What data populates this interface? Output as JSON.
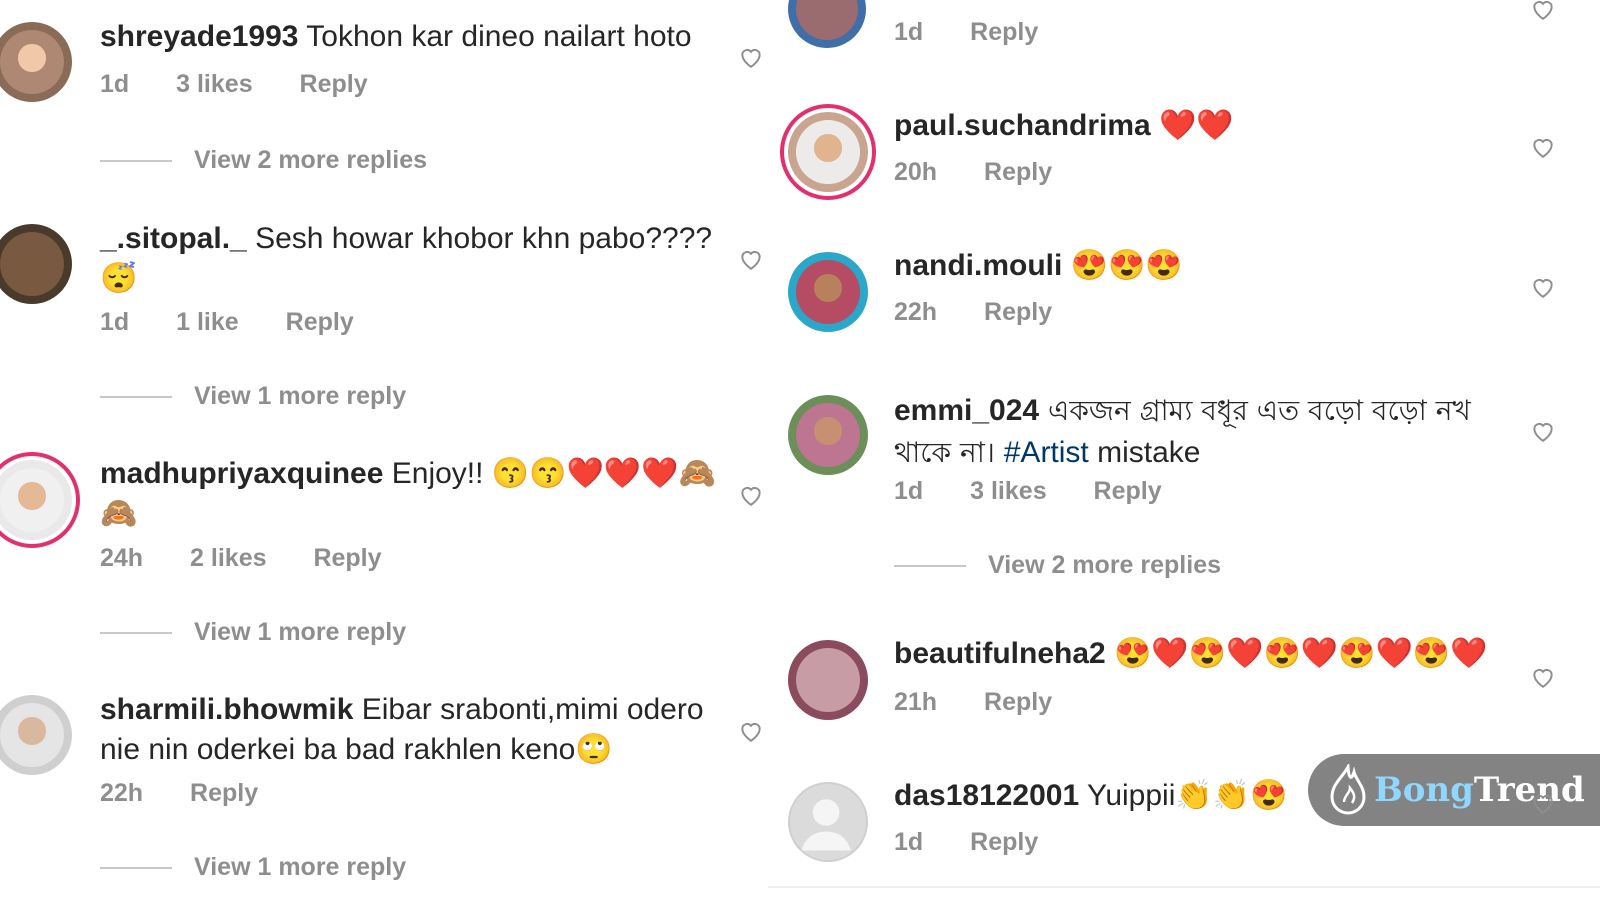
{
  "left_comments": [
    {
      "username": "shreyade1993",
      "text": "Tokhon kar dineo nailart hoto",
      "time": "1d",
      "likes": "3 likes",
      "reply": "Reply",
      "view_more": "View 2 more replies",
      "avatar_color": "#7a5c4a"
    },
    {
      "username": "_.sitopal._",
      "text": "Sesh howar khobor khn pabo???? 😴",
      "time": "1d",
      "likes": "1 like",
      "reply": "Reply",
      "view_more": "View 1 more reply",
      "avatar_color": "#5a4432"
    },
    {
      "username": "madhupriyaxquinee",
      "text": "Enjoy!! 😙😙❤️❤️❤️🙈🙈",
      "time": "24h",
      "likes": "2 likes",
      "reply": "Reply",
      "view_more": "View 1 more reply",
      "avatar_color": "#d9d9d9"
    },
    {
      "username": "sharmili.bhowmik",
      "text": "Eibar srabonti,mimi odero nie nin oderkei ba bad rakhlen keno🙄",
      "time": "22h",
      "likes": "",
      "reply": "Reply",
      "view_more": "View 1 more reply",
      "avatar_color": "#bdbdbd"
    }
  ],
  "right_comments": [
    {
      "username": "",
      "text": "",
      "time": "1d",
      "likes": "",
      "reply": "Reply",
      "avatar_color": "#3f6ea8"
    },
    {
      "username": "paul.suchandrima",
      "text": "❤️❤️",
      "time": "20h",
      "likes": "",
      "reply": "Reply",
      "avatar_color": "#c9a48e"
    },
    {
      "username": "nandi.mouli",
      "text": "😍😍😍",
      "time": "22h",
      "likes": "",
      "reply": "Reply",
      "avatar_color": "#2aa7c9"
    },
    {
      "username": "emmi_024",
      "text_plain_1": "একজন গ্রাম্য বধূর এত বড়ো বড়ো নখ থাকে না। ",
      "hashtag": "#Artist",
      "text_plain_2": " mistake",
      "time": "1d",
      "likes": "3 likes",
      "reply": "Reply",
      "view_more": "View 2 more replies",
      "avatar_color": "#6c8f5a"
    },
    {
      "username": "beautifulneha2",
      "text": "😍❤️😍❤️😍❤️😍❤️😍❤️",
      "time": "21h",
      "likes": "",
      "reply": "Reply",
      "avatar_color": "#8a4b5e"
    },
    {
      "username": "das18122001",
      "text": "Yuippii👏👏😍",
      "time": "1d",
      "likes": "",
      "reply": "Reply",
      "avatar_color": "#dbdbdb"
    }
  ],
  "watermark": {
    "part1": "Bong",
    "part2": "Trend"
  },
  "colors": {
    "accent_ring": "#e1306c",
    "meta": "#8e8e8e",
    "hashtag": "#00376b"
  },
  "icons": {
    "like": "heart-outline-icon",
    "default_avatar": "person-silhouette-icon"
  }
}
